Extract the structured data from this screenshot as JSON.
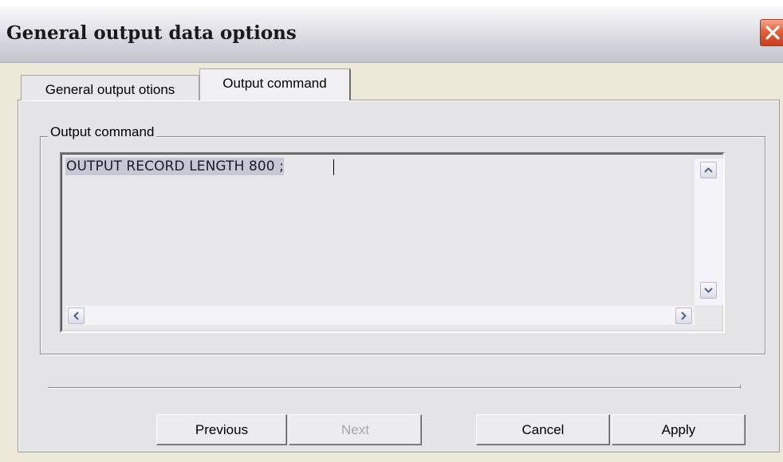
{
  "window": {
    "title": "General output data options",
    "close_icon": "close-icon"
  },
  "tabs": [
    {
      "label": "General output otions",
      "active": false
    },
    {
      "label": "Output command",
      "active": true
    }
  ],
  "output_command": {
    "group_label": "Output command",
    "text": "OUTPUT RECORD LENGTH 800 ;"
  },
  "scrollbars": {
    "icons": [
      "chevron-up-icon",
      "chevron-down-icon",
      "chevron-left-icon",
      "chevron-right-icon"
    ]
  },
  "buttons": {
    "previous": "Previous",
    "next": "Next",
    "cancel": "Cancel",
    "apply": "Apply",
    "next_enabled": false
  },
  "colors": {
    "close_button": "#e0603a",
    "dialog_background": "#e4e4e6",
    "selection": "#c8c8d4"
  }
}
